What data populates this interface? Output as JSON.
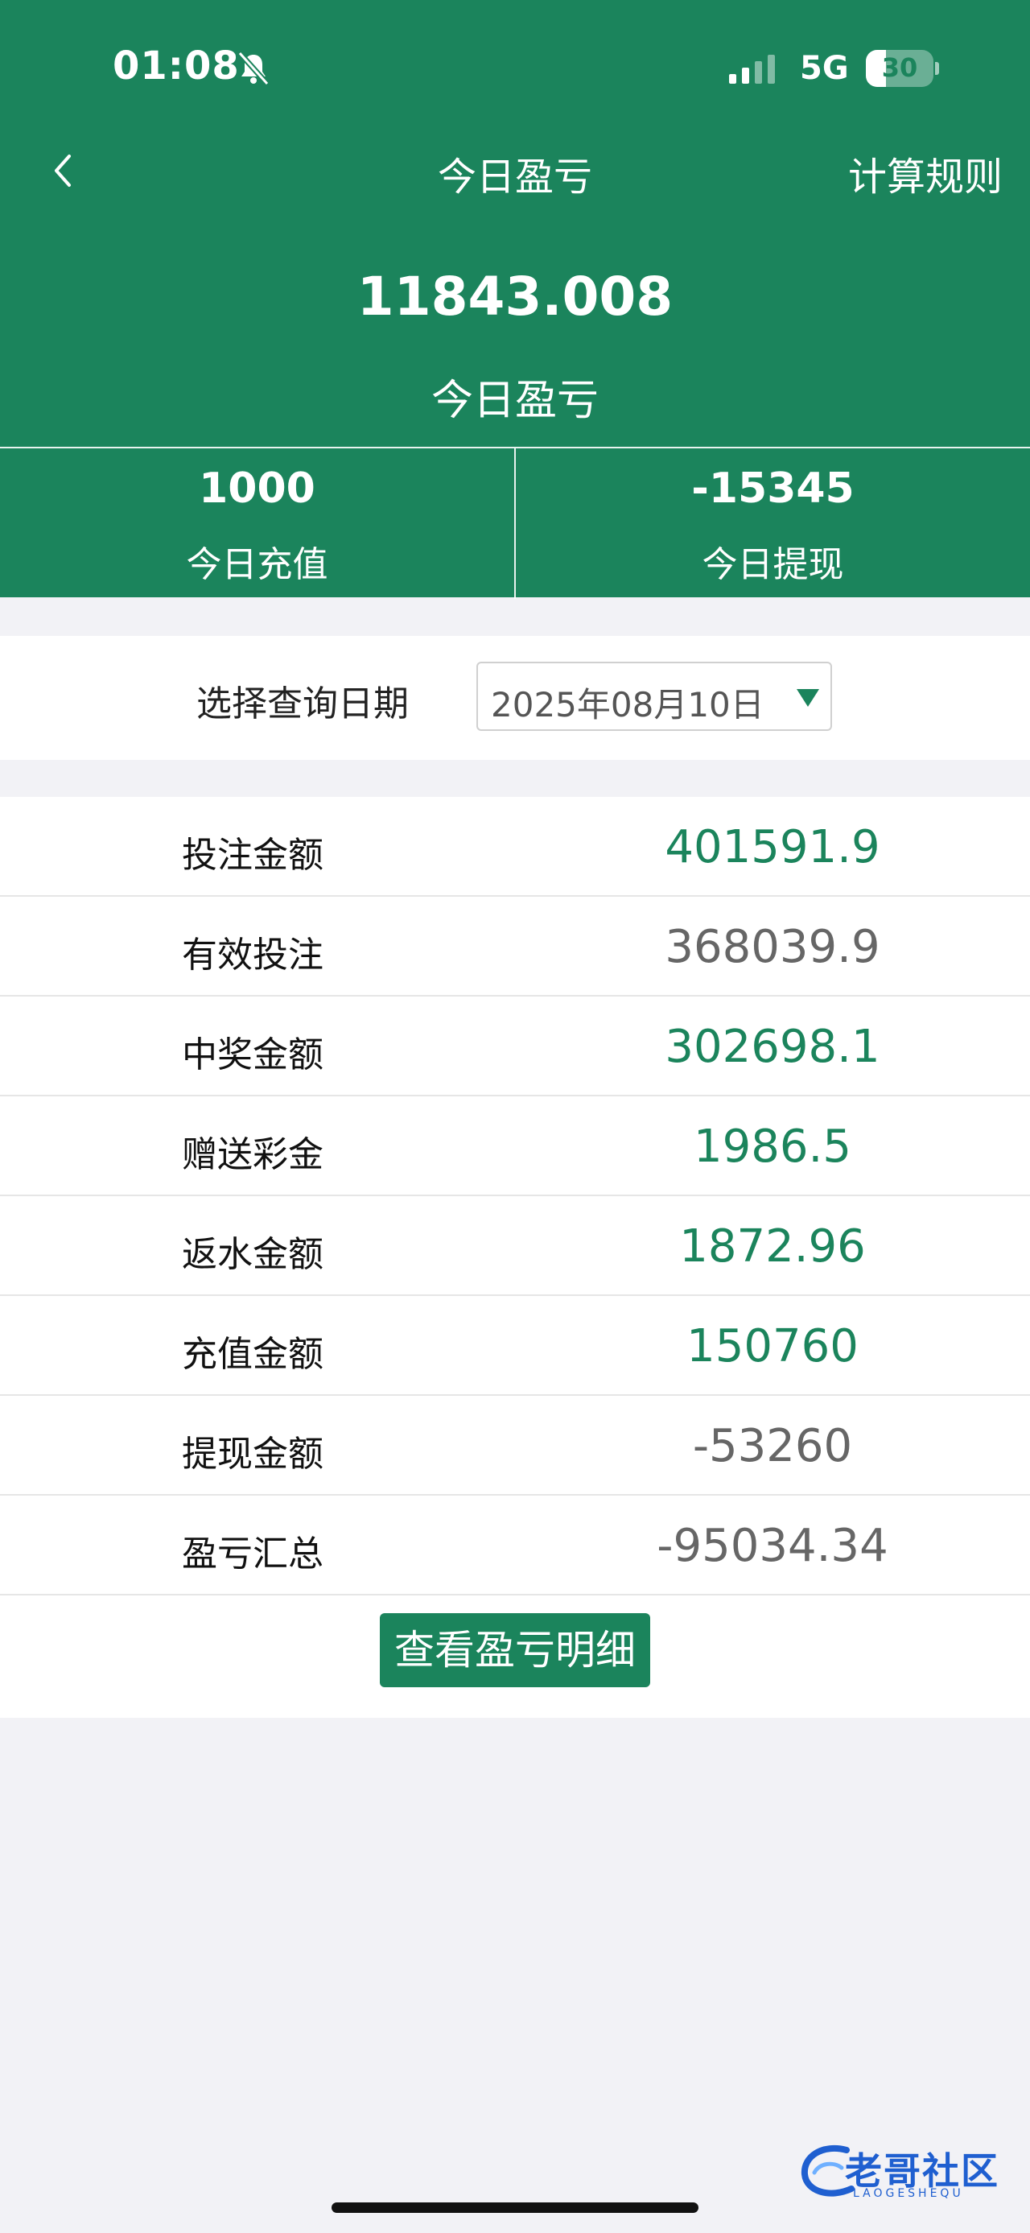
{
  "status_bar": {
    "time": "01:08",
    "network": "5G",
    "battery": "30",
    "battery_level": 0.3
  },
  "nav": {
    "title": "今日盈亏",
    "rules": "计算规则"
  },
  "summary": {
    "value": "11843.008",
    "label": "今日盈亏"
  },
  "stats": [
    {
      "value": "1000",
      "label": "今日充值"
    },
    {
      "value": "-15345",
      "label": "今日提现"
    }
  ],
  "date_filter": {
    "label": "选择查询日期",
    "value": "2025年08月10日"
  },
  "rows": [
    {
      "label": "投注金额",
      "value": "401591.9",
      "color": "#1b845c"
    },
    {
      "label": "有效投注",
      "value": "368039.9",
      "color": "#666666"
    },
    {
      "label": "中奖金额",
      "value": "302698.1",
      "color": "#1b845c"
    },
    {
      "label": "赠送彩金",
      "value": "1986.5",
      "color": "#1b845c"
    },
    {
      "label": "返水金额",
      "value": "1872.96",
      "color": "#1b845c"
    },
    {
      "label": "充值金额",
      "value": "150760",
      "color": "#1b845c"
    },
    {
      "label": "提现金额",
      "value": "-53260",
      "color": "#666666"
    },
    {
      "label": "盈亏汇总",
      "value": "-95034.34",
      "color": "#666666"
    }
  ],
  "detail_button": "查看盈亏明细",
  "watermark": {
    "text": "老哥社区",
    "sub": "LAOGESHEQU"
  },
  "colors": {
    "primary": "#1b845c",
    "gray_value": "#666666"
  }
}
